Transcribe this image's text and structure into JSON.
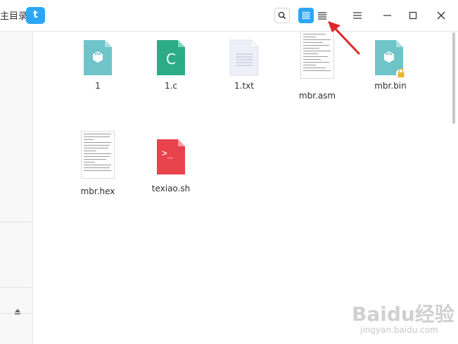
{
  "titlebar": {
    "crumb_text": "主目录",
    "crumb_tab": "t"
  },
  "files": [
    {
      "name": "1",
      "icon": "generic-file-icon"
    },
    {
      "name": "1.c",
      "icon": "c-source-icon",
      "glyph": "C"
    },
    {
      "name": "1.txt",
      "icon": "text-file-icon"
    },
    {
      "name": "mbr.asm",
      "icon": "document-preview-icon"
    },
    {
      "name": "mbr.bin",
      "icon": "binary-file-locked-icon"
    },
    {
      "name": "mbr.hex",
      "icon": "document-preview-icon"
    },
    {
      "name": "texiao.sh",
      "icon": "shell-script-icon",
      "glyph": ">_"
    }
  ],
  "watermark": {
    "text": "Baidu经验",
    "url": "jingyan.baidu.com"
  },
  "colors": {
    "accent": "#2ca7f8",
    "generic_file": "#6ec4c9",
    "c_file": "#2bab86",
    "shell_file": "#e8434d",
    "arrow": "#e0262a"
  }
}
